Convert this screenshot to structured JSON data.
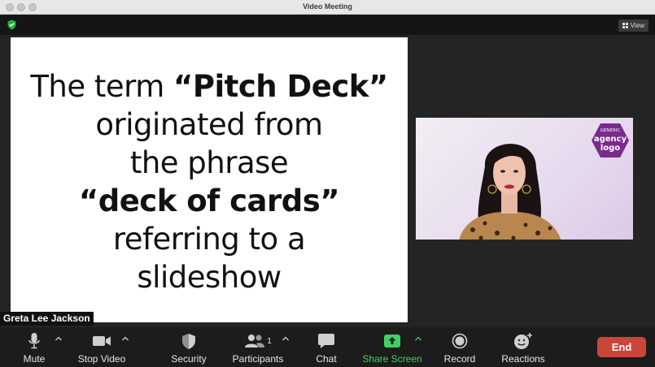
{
  "window": {
    "title": "Video Meeting"
  },
  "topbar": {
    "view_label": "View"
  },
  "slide": {
    "lines": [
      {
        "parts": [
          {
            "text": "The term ",
            "bold": false
          },
          {
            "text": "“Pitch Deck”",
            "bold": true
          }
        ]
      },
      {
        "parts": [
          {
            "text": "originated from",
            "bold": false
          }
        ]
      },
      {
        "parts": [
          {
            "text": "the phrase",
            "bold": false
          }
        ]
      },
      {
        "parts": [
          {
            "text": "“deck of cards”",
            "bold": true
          }
        ]
      },
      {
        "parts": [
          {
            "text": "referring to a",
            "bold": false
          }
        ]
      },
      {
        "parts": [
          {
            "text": "slideshow",
            "bold": false
          }
        ]
      }
    ]
  },
  "video": {
    "logo": {
      "line1": "GENERIC",
      "line2": "agency",
      "line3": "logo"
    }
  },
  "participant": {
    "name": "Greta Lee Jackson"
  },
  "toolbar": {
    "mute": "Mute",
    "stop_video": "Stop Video",
    "security": "Security",
    "participants": "Participants",
    "participant_count": "1",
    "chat": "Chat",
    "share_screen": "Share Screen",
    "record": "Record",
    "reactions": "Reactions",
    "end": "End"
  },
  "colors": {
    "share_green": "#3fd160",
    "end_red": "#c9463d",
    "logo_purple": "#7a2a8c"
  }
}
